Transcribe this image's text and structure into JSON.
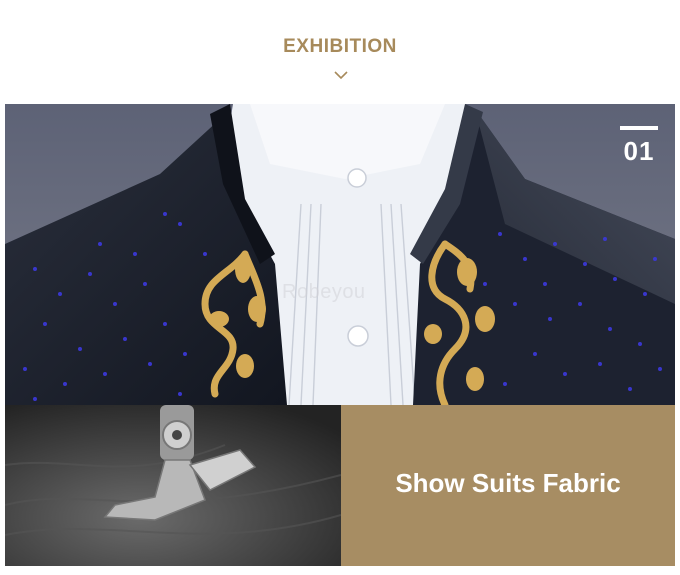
{
  "header": {
    "title": "EXHIBITION"
  },
  "hero": {
    "badge_number": "01",
    "watermark": "Robeyou"
  },
  "feature": {
    "title": "Show Suits Fabric"
  },
  "colors": {
    "accent": "#a78a5b",
    "panel": "#a78d63",
    "jacket": "#1d2230",
    "sequin": "#3b38d6",
    "embroidery": "#d4aa55"
  },
  "icons": {
    "chevron": "chevron-down-icon"
  }
}
